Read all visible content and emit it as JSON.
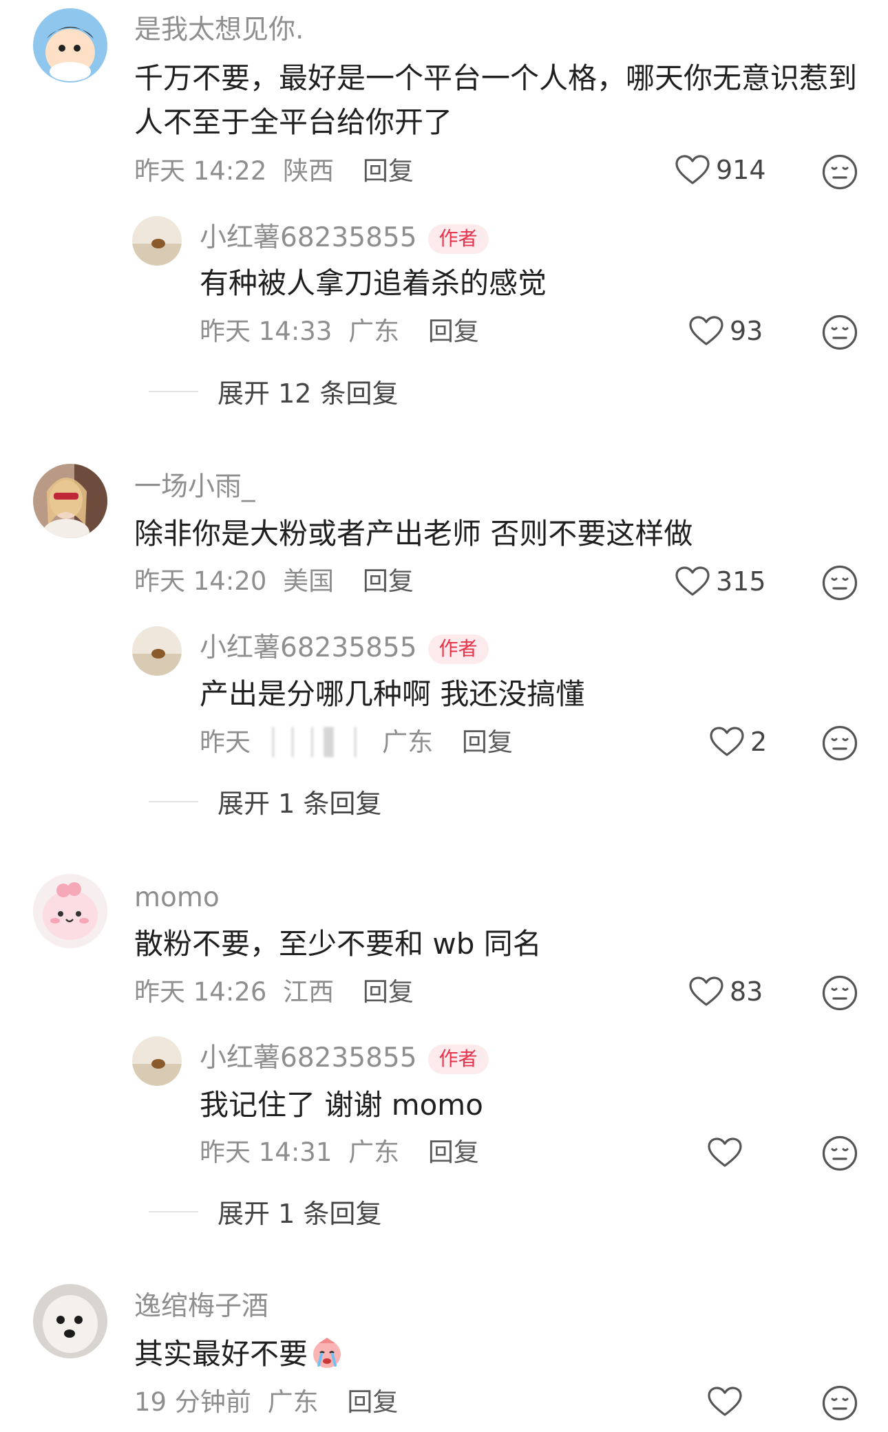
{
  "comments": [
    {
      "user": "是我太想见你.",
      "text_lines": [
        "千万不要，最好是一个平台一个人格，哪天你无意识惹到",
        "人不至于全平台给你开了"
      ],
      "time": "昨天 14:22",
      "location": "陕西",
      "reply_label": "回复",
      "likes": "914",
      "reply": {
        "user": "小红薯68235855",
        "badge": "作者",
        "text": "有种被人拿刀追着杀的感觉",
        "time": "昨天 14:33",
        "location": "广东",
        "reply_label": "回复",
        "likes": "93"
      },
      "expand": "展开 12 条回复"
    },
    {
      "user": "一场小雨_",
      "text_lines": [
        "除非你是大粉或者产出老师 否则不要这样做"
      ],
      "time": "昨天 14:20",
      "location": "美国",
      "reply_label": "回复",
      "likes": "315",
      "reply": {
        "user": "小红薯68235855",
        "badge": "作者",
        "text": "产出是分哪几种啊 我还没搞懂",
        "time": "昨天",
        "location": "广东",
        "reply_label": "回复",
        "likes": "2"
      },
      "expand": "展开 1 条回复"
    },
    {
      "user": "momo",
      "text_lines": [
        "散粉不要，至少不要和 wb 同名"
      ],
      "time": "昨天 14:26",
      "location": "江西",
      "reply_label": "回复",
      "likes": "83",
      "reply": {
        "user": "小红薯68235855",
        "badge": "作者",
        "text": "我记住了 谢谢 momo",
        "time": "昨天 14:31",
        "location": "广东",
        "reply_label": "回复",
        "likes": ""
      },
      "expand": "展开 1 条回复"
    },
    {
      "user": "逸绾梅子酒",
      "text_lines": [
        "其实最好不要"
      ],
      "time": "19 分钟前",
      "location": "广东",
      "reply_label": "回复",
      "likes": ""
    }
  ],
  "icons": {
    "like": "heart-outline-icon",
    "react": "meh-face-icon",
    "emoji": "crying-emoji-icon"
  }
}
